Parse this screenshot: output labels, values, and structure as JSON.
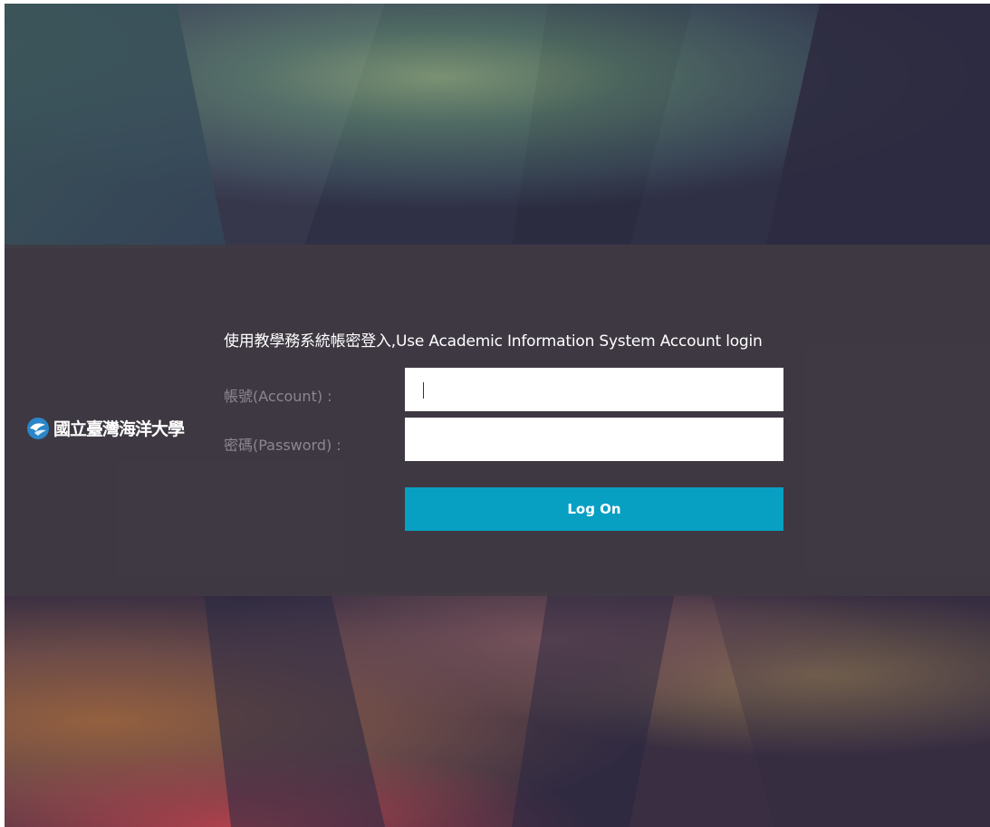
{
  "login": {
    "heading": "使用教學務系統帳密登入,Use Academic Information System Account login",
    "account_label": "帳號(Account) :",
    "account_value": "",
    "password_label": "密碼(Password) :",
    "password_value": "",
    "logon_label": "Log On"
  },
  "branding": {
    "logo_text": "國立臺灣海洋大學",
    "logo_icon": "ntou-wave-emblem-icon"
  },
  "colors": {
    "button": "#07a0c3",
    "band": "#403a42",
    "label": "#8b8690",
    "heading": "#ffffff"
  }
}
